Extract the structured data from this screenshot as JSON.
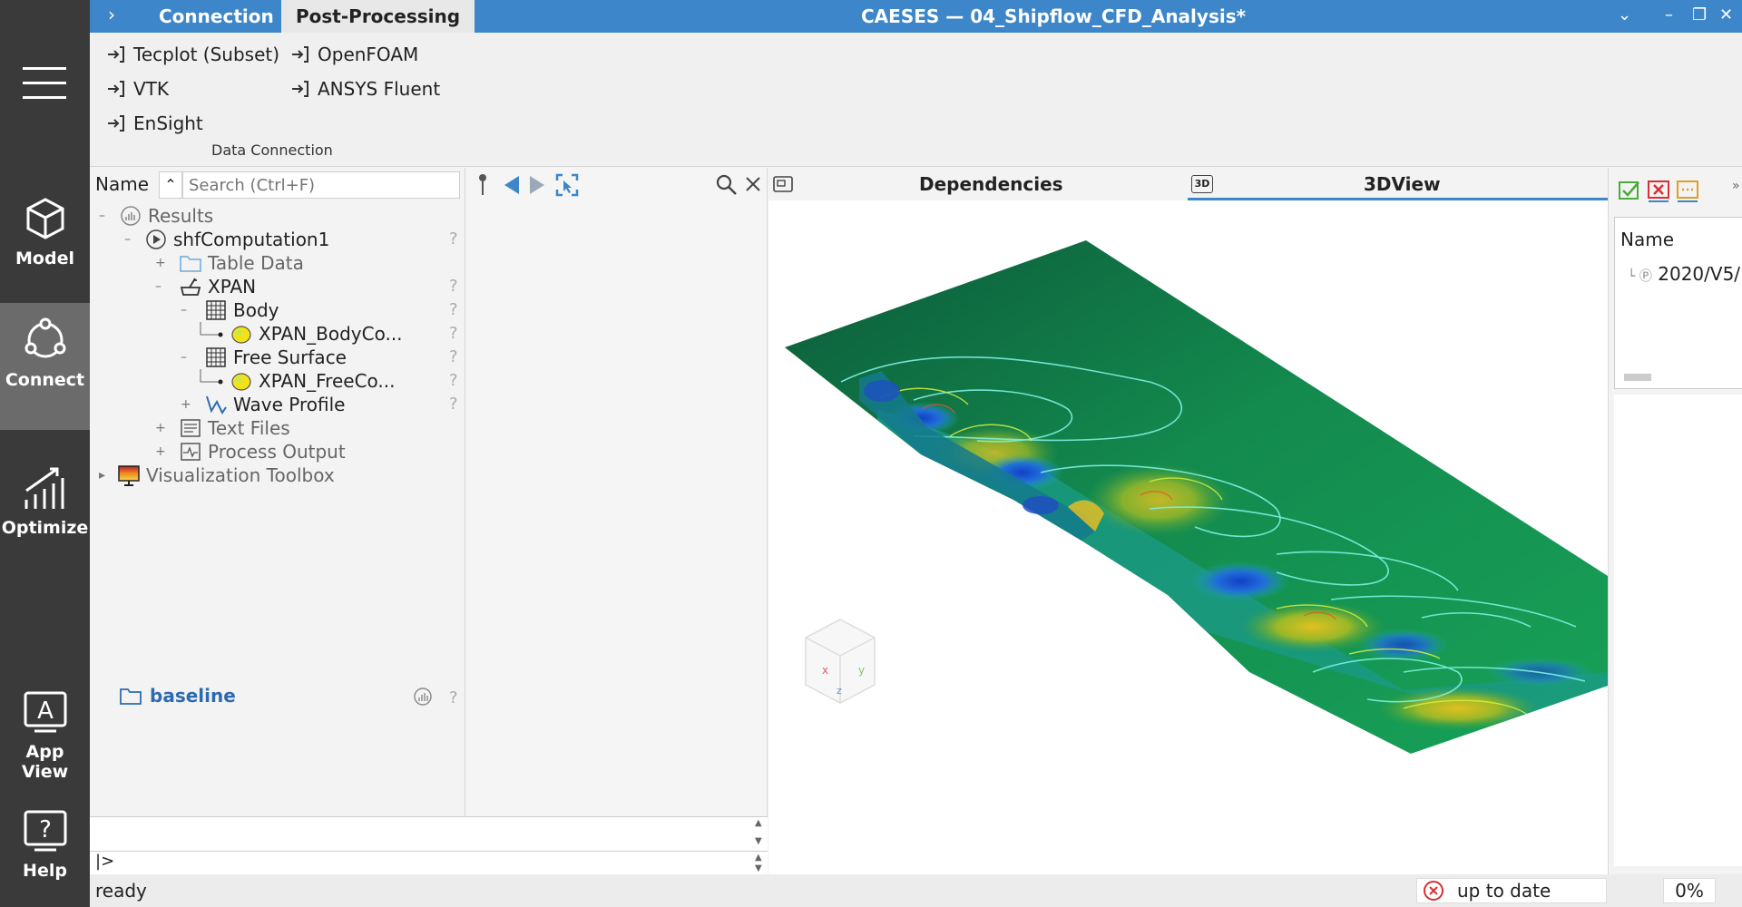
{
  "app": {
    "title": "CAESES — 04_Shipflow_CFD_Analysis*",
    "tabs": [
      {
        "label": "Connection",
        "active": false
      },
      {
        "label": "Post-Processing",
        "active": true
      }
    ]
  },
  "rail": {
    "items": [
      {
        "label": "Model",
        "icon": "cube-icon",
        "active": false
      },
      {
        "label": "Connect",
        "icon": "connect-icon",
        "active": true
      },
      {
        "label": "Optimize",
        "icon": "chart-icon",
        "active": false
      },
      {
        "label": "App View",
        "icon": "app-view-icon",
        "active": false
      },
      {
        "label": "Help",
        "icon": "help-icon",
        "active": false
      }
    ]
  },
  "ribbon": {
    "group_label": "Data Connection",
    "items": [
      "Tecplot (Subset)",
      "VTK",
      "EnSight",
      "OpenFOAM",
      "ANSYS Fluent"
    ]
  },
  "tree": {
    "header": "Name",
    "search_placeholder": "Search (Ctrl+F)",
    "results": "Results",
    "computation": "shfComputation1",
    "table_data": "Table Data",
    "xpan": "XPAN",
    "body": "Body",
    "body_contour": "XPAN_BodyCo...",
    "free_surface": "Free Surface",
    "fs_contour": "XPAN_FreeCo...",
    "wave_profile": "Wave Profile",
    "text_files": "Text Files",
    "process_output": "Process Output",
    "vis_toolbox": "Visualization Toolbox",
    "qmark": "?",
    "baseline": "baseline"
  },
  "console": {
    "prompt": "|>"
  },
  "view": {
    "tab_dependencies": "Dependencies",
    "tab_3dview": "3DView",
    "tab_3d_badge": "3D"
  },
  "rightpanel": {
    "header": "Name",
    "row": "2020/V5/"
  },
  "status": {
    "text": "ready",
    "sync": "up to date",
    "progress": "0%"
  },
  "colors": {
    "accent": "#3c86c9",
    "rail": "#3a3a3a",
    "rail_active": "#6b6b6b",
    "link": "#2d6bb0"
  }
}
